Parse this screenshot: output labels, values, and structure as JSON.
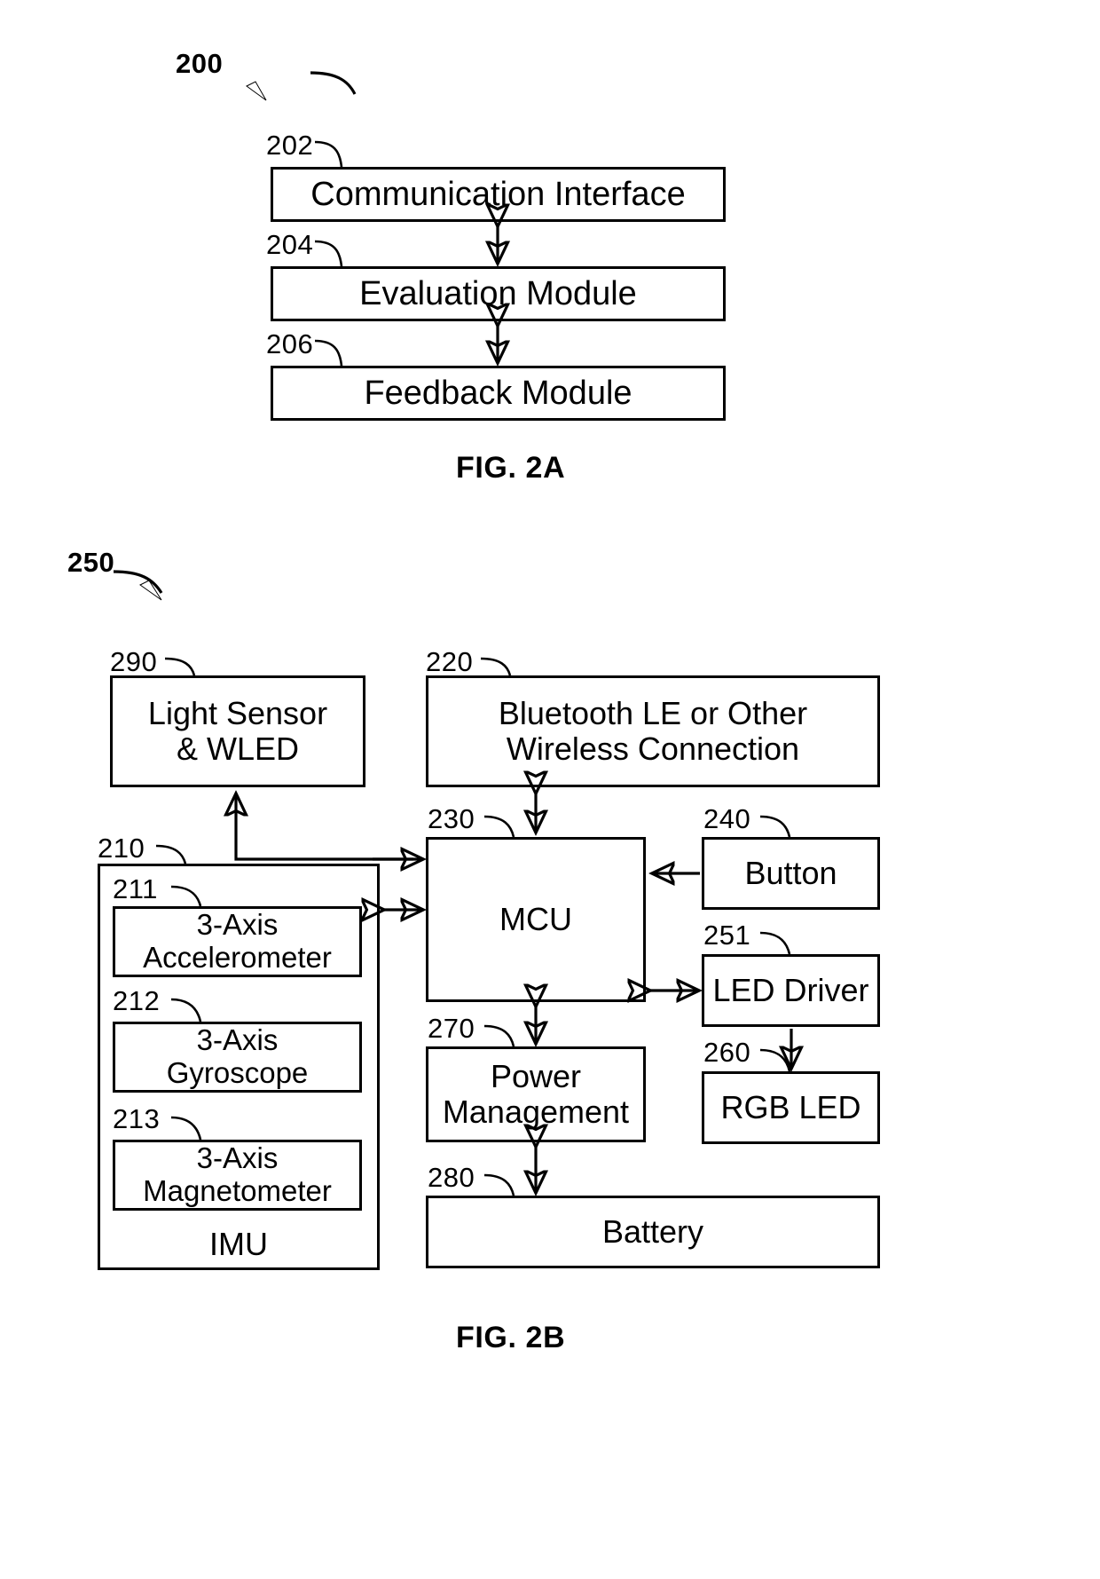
{
  "figures": [
    {
      "id": "fig2a",
      "caption": "FIG. 2A",
      "system_ref": "200",
      "blocks": [
        {
          "ref": "202",
          "label": "Communication Interface"
        },
        {
          "ref": "204",
          "label": "Evaluation Module"
        },
        {
          "ref": "206",
          "label": "Feedback Module"
        }
      ],
      "connections": [
        {
          "from": "202",
          "to": "204",
          "type": "bidirectional"
        },
        {
          "from": "204",
          "to": "206",
          "type": "bidirectional"
        }
      ]
    },
    {
      "id": "fig2b",
      "caption": "FIG. 2B",
      "system_ref": "250",
      "blocks": [
        {
          "ref": "290",
          "label": "Light Sensor\n& WLED"
        },
        {
          "ref": "220",
          "label": "Bluetooth LE or Other\nWireless Connection"
        },
        {
          "ref": "230",
          "label": "MCU"
        },
        {
          "ref": "240",
          "label": "Button"
        },
        {
          "ref": "251",
          "label": "LED Driver"
        },
        {
          "ref": "260",
          "label": "RGB LED"
        },
        {
          "ref": "270",
          "label": "Power\nManagement"
        },
        {
          "ref": "280",
          "label": "Battery"
        },
        {
          "ref": "210",
          "label": "IMU"
        },
        {
          "ref": "211",
          "label": "3-Axis\nAccelerometer"
        },
        {
          "ref": "212",
          "label": "3-Axis\nGyroscope"
        },
        {
          "ref": "213",
          "label": "3-Axis\nMagnetometer"
        }
      ],
      "connections": [
        {
          "from": "220",
          "to": "230",
          "type": "bidirectional"
        },
        {
          "from": "240",
          "to": "230",
          "type": "unidirectional"
        },
        {
          "from": "230",
          "to": "251",
          "type": "bidirectional"
        },
        {
          "from": "251",
          "to": "260",
          "type": "unidirectional"
        },
        {
          "from": "230",
          "to": "270",
          "type": "bidirectional"
        },
        {
          "from": "270",
          "to": "280",
          "type": "bidirectional"
        },
        {
          "from": "210",
          "to": "230",
          "type": "bidirectional"
        },
        {
          "from": "210",
          "to": "290",
          "type": "unidirectional"
        }
      ]
    }
  ]
}
